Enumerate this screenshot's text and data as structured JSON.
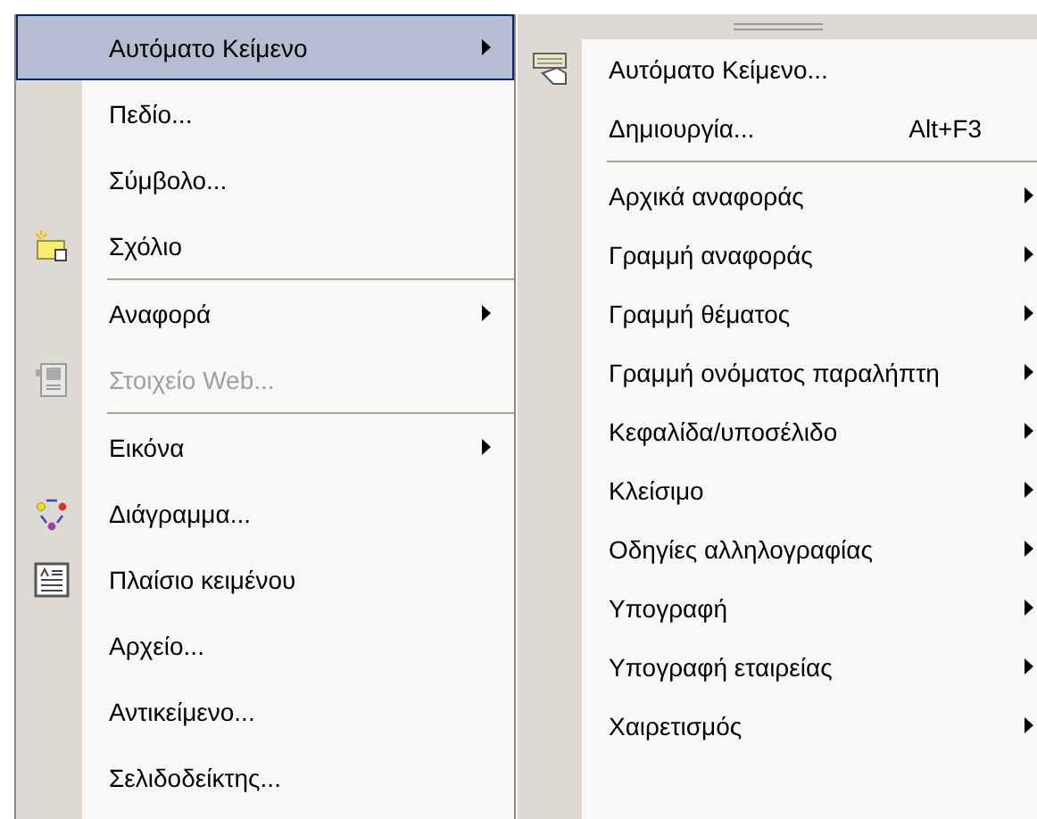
{
  "insert_menu": {
    "items": [
      {
        "kind": "item",
        "label": "Αυτόματο Κείμενο",
        "submenu": true,
        "selected": true,
        "disabled": false
      },
      {
        "kind": "item",
        "label": "Πεδίο...",
        "submenu": false,
        "selected": false,
        "disabled": false
      },
      {
        "kind": "item",
        "label": "Σύμβολο...",
        "submenu": false,
        "selected": false,
        "disabled": false
      },
      {
        "kind": "item",
        "label": "Σχόλιο",
        "submenu": false,
        "selected": false,
        "disabled": false
      },
      {
        "kind": "separator"
      },
      {
        "kind": "item",
        "label": "Αναφορά",
        "submenu": true,
        "selected": false,
        "disabled": false
      },
      {
        "kind": "item",
        "label": "Στοιχείο Web...",
        "submenu": false,
        "selected": false,
        "disabled": true
      },
      {
        "kind": "separator"
      },
      {
        "kind": "item",
        "label": "Εικόνα",
        "submenu": true,
        "selected": false,
        "disabled": false
      },
      {
        "kind": "item",
        "label": "Διάγραμμα...",
        "submenu": false,
        "selected": false,
        "disabled": false
      },
      {
        "kind": "item",
        "label": "Πλαίσιο κειμένου",
        "submenu": false,
        "selected": false,
        "disabled": false
      },
      {
        "kind": "item",
        "label": "Αρχείο...",
        "submenu": false,
        "selected": false,
        "disabled": false
      },
      {
        "kind": "item",
        "label": "Αντικείμενο...",
        "submenu": false,
        "selected": false,
        "disabled": false
      },
      {
        "kind": "item",
        "label": "Σελιδοδείκτης...",
        "submenu": false,
        "selected": false,
        "disabled": false
      }
    ]
  },
  "autotext_submenu": {
    "items": [
      {
        "kind": "item",
        "label": "Αυτόματο Κείμενο...",
        "submenu": false,
        "selected": false,
        "disabled": false
      },
      {
        "kind": "item",
        "label": "Δημιουργία...",
        "shortcut": "Alt+F3",
        "submenu": false,
        "selected": false,
        "disabled": false
      },
      {
        "kind": "separator"
      },
      {
        "kind": "item",
        "label": "Αρχικά αναφοράς",
        "submenu": true,
        "selected": false,
        "disabled": false
      },
      {
        "kind": "item",
        "label": "Γραμμή αναφοράς",
        "submenu": true,
        "selected": false,
        "disabled": false
      },
      {
        "kind": "item",
        "label": "Γραμμή θέματος",
        "submenu": true,
        "selected": false,
        "disabled": false
      },
      {
        "kind": "item",
        "label": "Γραμμή ονόματος παραλήπτη",
        "submenu": true,
        "selected": false,
        "disabled": false
      },
      {
        "kind": "item",
        "label": "Κεφαλίδα/υποσέλιδο",
        "submenu": true,
        "selected": false,
        "disabled": false
      },
      {
        "kind": "item",
        "label": "Κλείσιμο",
        "submenu": true,
        "selected": false,
        "disabled": false
      },
      {
        "kind": "item",
        "label": "Οδηγίες αλληλογραφίας",
        "submenu": true,
        "selected": false,
        "disabled": false
      },
      {
        "kind": "item",
        "label": "Υπογραφή",
        "submenu": true,
        "selected": false,
        "disabled": false
      },
      {
        "kind": "item",
        "label": "Υπογραφή εταιρείας",
        "submenu": true,
        "selected": false,
        "disabled": false
      },
      {
        "kind": "item",
        "label": "Χαιρετισμός",
        "submenu": true,
        "selected": false,
        "disabled": false
      }
    ]
  }
}
